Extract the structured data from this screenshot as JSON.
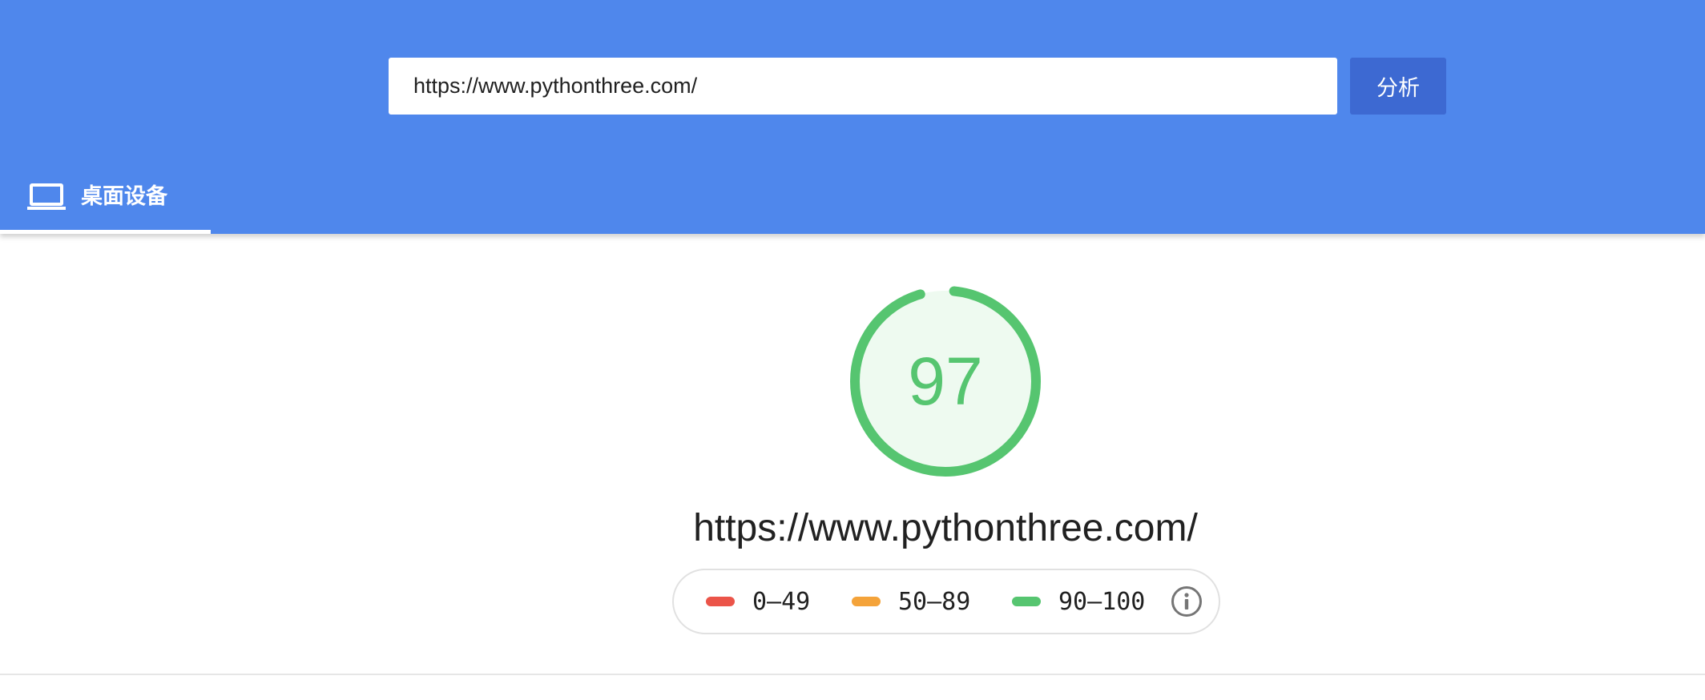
{
  "search": {
    "value": "https://www.pythonthree.com/",
    "analyze_label": "分析"
  },
  "tabs": [
    {
      "label": "桌面设备",
      "icon": "laptop-icon",
      "active": true
    }
  ],
  "report": {
    "score": "97",
    "score_fraction": 0.97,
    "url": "https://www.pythonthree.com/"
  },
  "legend": {
    "items": [
      {
        "label": "0–49",
        "color": "#eb5449"
      },
      {
        "label": "50–89",
        "color": "#f4a33a"
      },
      {
        "label": "90–100",
        "color": "#56c570"
      }
    ],
    "info_icon": "info-icon"
  },
  "colors": {
    "header_bg": "#4f87ec",
    "button_bg": "#3d69d2",
    "pass_green": "#56c570",
    "gauge_fill": "#eefaf0"
  }
}
